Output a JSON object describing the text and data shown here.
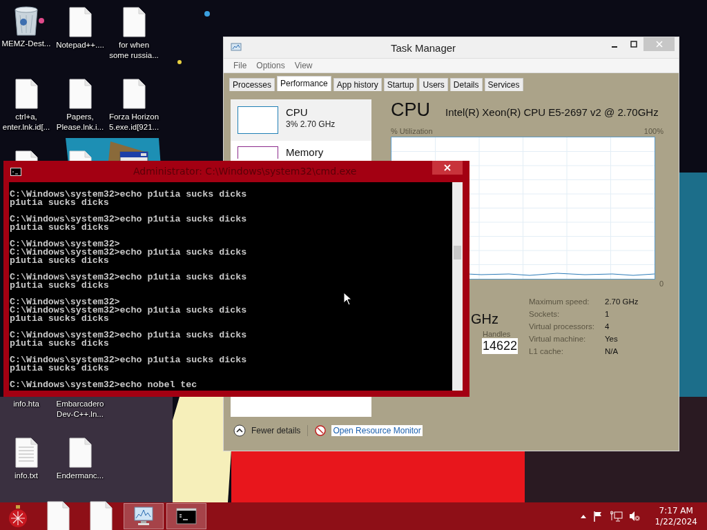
{
  "desktop_icons": [
    {
      "kind": "recycle",
      "label": "MEMZ-Dest..."
    },
    {
      "kind": "file",
      "label": "Notepad++...."
    },
    {
      "kind": "file",
      "label": "for when\nsome russia..."
    },
    {
      "kind": "file",
      "label": "ctrl+a,\nenter.lnk.id[..."
    },
    {
      "kind": "file",
      "label": "Papers,\nPlease.lnk.i..."
    },
    {
      "kind": "file",
      "label": "Forza Horizon\n5.exe.id[921..."
    },
    {
      "kind": "file"
    },
    {
      "kind": "file"
    },
    {
      "kind": "app"
    },
    {
      "label": "info.hta"
    },
    {
      "label": "Embarcadero\nDev-C++.ln..."
    },
    {
      "kind": "text",
      "label": "info.txt"
    },
    {
      "kind": "file",
      "label": "Endermanc..."
    }
  ],
  "task_manager": {
    "title": "Task Manager",
    "menu": [
      "File",
      "Options",
      "View"
    ],
    "tabs": [
      {
        "label": "Processes",
        "selected": false
      },
      {
        "label": "Performance",
        "selected": true
      },
      {
        "label": "App history",
        "selected": false
      },
      {
        "label": "Startup",
        "selected": false
      },
      {
        "label": "Users",
        "selected": false
      },
      {
        "label": "Details",
        "selected": false
      },
      {
        "label": "Services",
        "selected": false
      }
    ],
    "sidebar": [
      {
        "name": "CPU",
        "detail": "3%  2.70 GHz",
        "selected": true,
        "color": "#1f7fb5"
      },
      {
        "name": "Memory",
        "selected": false,
        "color": "#8b2a8b"
      }
    ],
    "heading": "CPU",
    "model": "Intel(R) Xeon(R) CPU E5-2697 v2 @ 2.70GHz",
    "utilization_label": "% Utilization",
    "max_label": "100%",
    "min_label": "0",
    "speed_fragment": "GHz",
    "handles_label": "Handles",
    "handles_value": "14622",
    "specs": [
      {
        "label": "Maximum speed:",
        "value": "2.70 GHz"
      },
      {
        "label": "Sockets:",
        "value": "1"
      },
      {
        "label": "Virtual processors:",
        "value": "4"
      },
      {
        "label": "Virtual machine:",
        "value": "Yes"
      },
      {
        "label": "L1 cache:",
        "value": "N/A"
      }
    ],
    "fewer_details": "Fewer details",
    "resource_monitor": "Open Resource Monitor"
  },
  "console": {
    "title": "Administrator: C:\\Windows\\system32\\cmd.exe",
    "blocks": [
      [
        "C:\\Windows\\system32>echo p1utia sucks dicks",
        "p1utia sucks dicks"
      ],
      [
        "C:\\Windows\\system32>echo p1utia sucks dicks",
        "p1utia sucks dicks"
      ],
      [
        "C:\\Windows\\system32>",
        "C:\\Windows\\system32>echo p1utia sucks dicks",
        "p1utia sucks dicks"
      ],
      [
        "C:\\Windows\\system32>echo p1utia sucks dicks",
        "p1utia sucks dicks"
      ],
      [
        "C:\\Windows\\system32>",
        "C:\\Windows\\system32>echo p1utia sucks dicks",
        "p1utia sucks dicks"
      ],
      [
        "C:\\Windows\\system32>echo p1utia sucks dicks",
        "p1utia sucks dicks"
      ],
      [
        "C:\\Windows\\system32>echo p1utia sucks dicks",
        "p1utia sucks dicks"
      ],
      [
        "C:\\Windows\\system32>echo nobel tec"
      ]
    ]
  },
  "taskbar": {
    "buttons": [
      {
        "kind": "start",
        "running": false
      },
      {
        "kind": "file",
        "running": false
      },
      {
        "kind": "file",
        "running": false
      },
      {
        "kind": "taskmgr",
        "running": true
      },
      {
        "kind": "cmd",
        "running": true
      }
    ],
    "time": "7:17 AM",
    "date": "1/22/2024"
  }
}
